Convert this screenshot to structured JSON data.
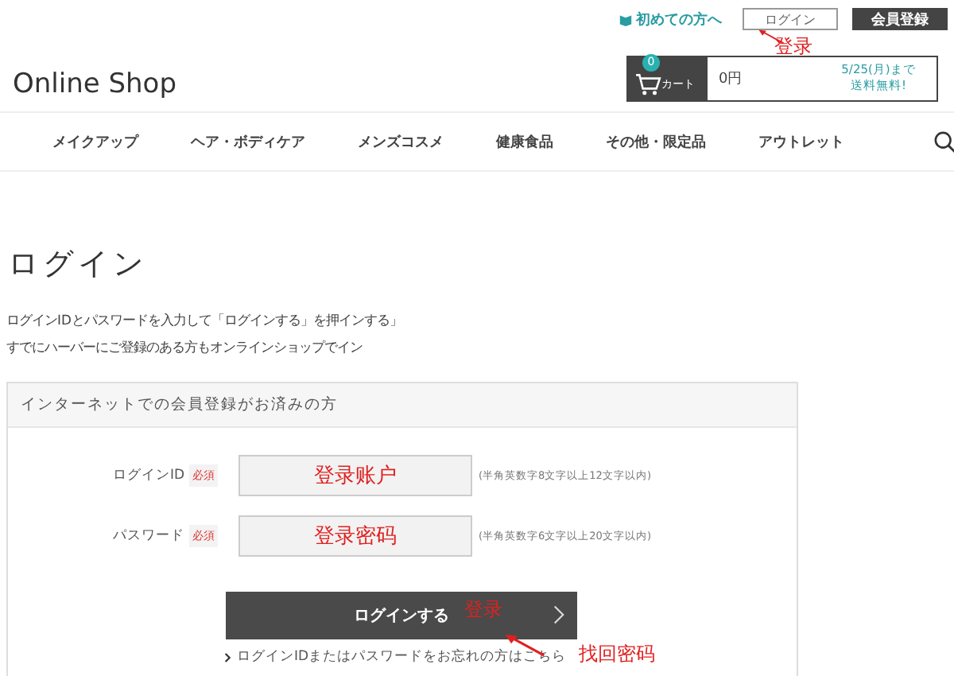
{
  "header": {
    "logo": "Online Shop",
    "first_time_link": "初めての方へ",
    "login_button": "ログイン",
    "register_button": "会員登録",
    "cart": {
      "count": "0",
      "label": "カート",
      "total": "0円",
      "notice_line_1": "5/25(月)まで",
      "notice_line_2": "送料無料!"
    }
  },
  "nav": {
    "items": [
      "メイクアップ",
      "ヘア・ボディケア",
      "メンズコスメ",
      "健康食品",
      "その他・限定品",
      "アウトレット"
    ]
  },
  "page": {
    "title": "ログイン",
    "intro_lines": [
      "ログインIDとパスワードを入力して「ログインする」を押インする」",
      "すでにハーバーにご登録のある方もオンラインショップでイン"
    ]
  },
  "login_panel": {
    "heading": "インターネットでの会員登録がお済みの方",
    "fields": [
      {
        "label": "ログインID",
        "required": "必須",
        "value": "登录账户",
        "hint": "(半角英数字8文字以上12文字以内)"
      },
      {
        "label": "パスワード",
        "required": "必須",
        "value": "登录密码",
        "hint": "(半角英数字6文字以上20文字以内)"
      }
    ],
    "submit": "ログインする",
    "forgot_link": "ログインIDまたはパスワードをお忘れの方はこちら"
  },
  "annotations": [
    {
      "kind": "arrow"
    },
    {
      "kind": "text",
      "text": "登录"
    },
    {
      "kind": "text",
      "text": "登录"
    },
    {
      "kind": "arrow"
    },
    {
      "kind": "text",
      "text": "找回密码"
    }
  ]
}
